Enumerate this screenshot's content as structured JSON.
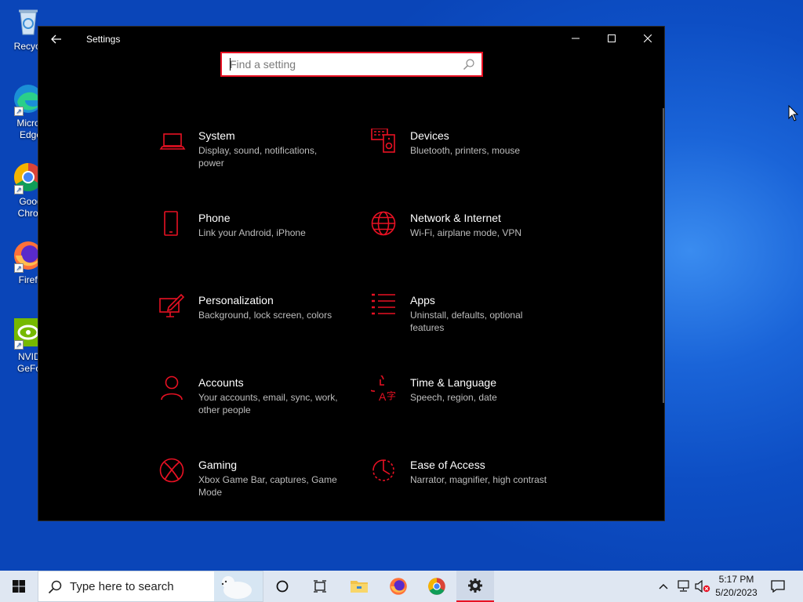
{
  "desktop": {
    "icons": [
      {
        "label": "Recycle",
        "icon": "recycle-bin-icon"
      },
      {
        "label": "Micros\nEdge",
        "icon": "edge-icon"
      },
      {
        "label": "Goog\nChron",
        "icon": "chrome-icon"
      },
      {
        "label": "Firefo",
        "icon": "firefox-icon"
      },
      {
        "label": "NVIDI\nGeFor",
        "icon": "nvidia-icon"
      }
    ]
  },
  "window": {
    "title": "Settings",
    "search_placeholder": "Find a setting",
    "accent_color": "#e81123"
  },
  "categories": [
    {
      "title": "System",
      "desc": "Display, sound, notifications, power",
      "icon": "laptop-icon"
    },
    {
      "title": "Devices",
      "desc": "Bluetooth, printers, mouse",
      "icon": "devices-icon"
    },
    {
      "title": "Phone",
      "desc": "Link your Android, iPhone",
      "icon": "phone-icon"
    },
    {
      "title": "Network & Internet",
      "desc": "Wi-Fi, airplane mode, VPN",
      "icon": "globe-icon"
    },
    {
      "title": "Personalization",
      "desc": "Background, lock screen, colors",
      "icon": "personalization-icon"
    },
    {
      "title": "Apps",
      "desc": "Uninstall, defaults, optional features",
      "icon": "apps-list-icon"
    },
    {
      "title": "Accounts",
      "desc": "Your accounts, email, sync, work, other people",
      "icon": "person-icon"
    },
    {
      "title": "Time & Language",
      "desc": "Speech, region, date",
      "icon": "time-language-icon"
    },
    {
      "title": "Gaming",
      "desc": "Xbox Game Bar, captures, Game Mode",
      "icon": "xbox-icon"
    },
    {
      "title": "Ease of Access",
      "desc": "Narrator, magnifier, high contrast",
      "icon": "ease-of-access-icon"
    }
  ],
  "taskbar": {
    "search_text": "Type here to search",
    "time": "5:17 PM",
    "date": "5/20/2023"
  }
}
